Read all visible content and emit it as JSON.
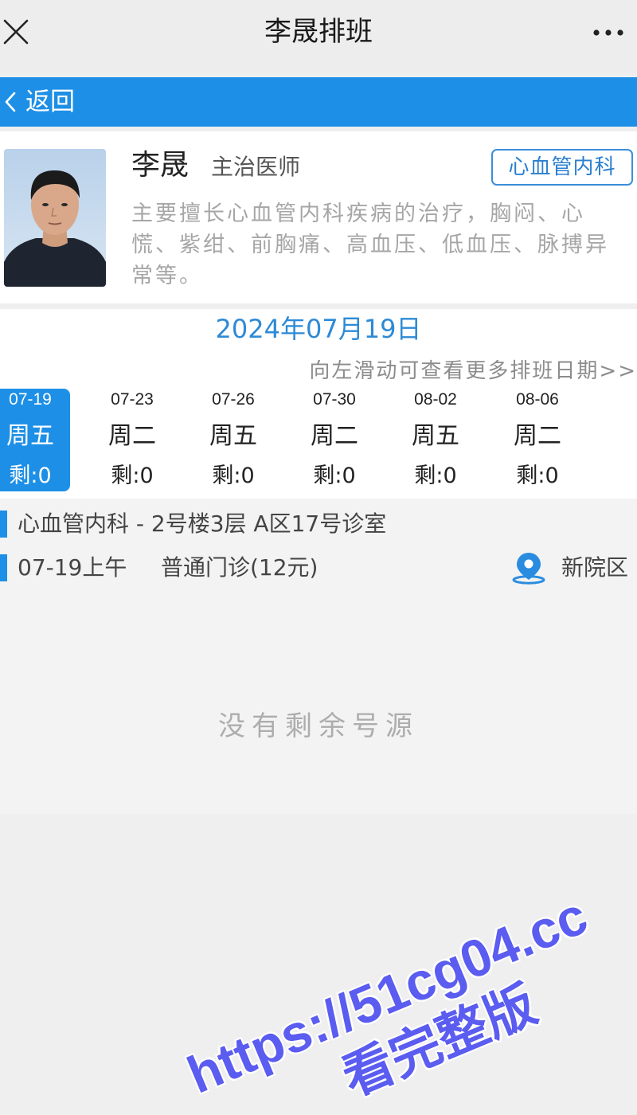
{
  "window": {
    "title": "李晟排班"
  },
  "nav": {
    "back_label": "返回"
  },
  "doctor": {
    "name": "李晟",
    "title": "主治医师",
    "department_badge": "心血管内科",
    "description": "主要擅长心血管内科疾病的治疗，胸闷、心慌、紫绀、前胸痛、高血压、低血压、脉搏异常等。"
  },
  "schedule": {
    "selected_date": "2024年07月19日",
    "swipe_hint": "向左滑动可查看更多排班日期>>",
    "days": [
      {
        "date": "07-19",
        "weekday": "周五",
        "remaining": "剩:0",
        "selected": true
      },
      {
        "date": "07-23",
        "weekday": "周二",
        "remaining": "剩:0",
        "selected": false
      },
      {
        "date": "07-26",
        "weekday": "周五",
        "remaining": "剩:0",
        "selected": false
      },
      {
        "date": "07-30",
        "weekday": "周二",
        "remaining": "剩:0",
        "selected": false
      },
      {
        "date": "08-02",
        "weekday": "周五",
        "remaining": "剩:0",
        "selected": false
      },
      {
        "date": "08-06",
        "weekday": "周二",
        "remaining": "剩:0",
        "selected": false
      }
    ]
  },
  "session": {
    "department_location": "心血管内科 - 2号楼3层 A区17号诊室",
    "time_slot": "07-19上午",
    "clinic_type": "普通门诊(12元)",
    "campus": "新院区"
  },
  "empty_state": {
    "message": "没有剩余号源"
  },
  "watermark": {
    "url": "https://51cg04.cc",
    "caption": "看完整版"
  },
  "icons": {
    "close": "close-icon",
    "more": "more-icon",
    "back": "chevron-left-icon",
    "location": "location-pin-icon"
  },
  "colors": {
    "accent": "#1e8fe6",
    "date_heading": "#2d8ad6",
    "watermark": "#5b5cf0"
  }
}
